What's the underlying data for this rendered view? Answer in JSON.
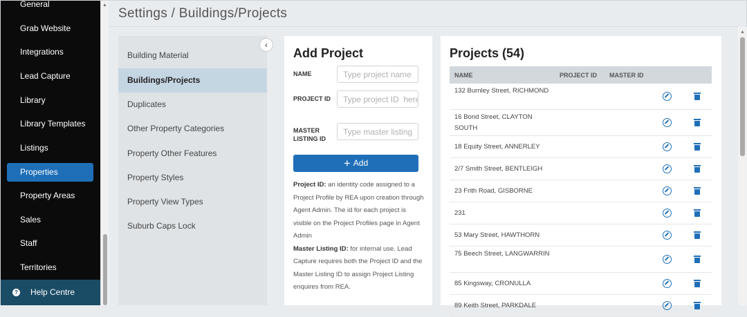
{
  "sidebar": {
    "items": [
      "General",
      "Grab Website",
      "Integrations",
      "Lead Capture",
      "Library",
      "Library Templates",
      "Listings",
      "Properties",
      "Property Areas",
      "Sales",
      "Staff",
      "Territories"
    ],
    "active": "Properties",
    "help": "Help Centre"
  },
  "header": {
    "title": "Settings / Buildings/Projects"
  },
  "settings_nav": {
    "items": [
      "Building Material",
      "Buildings/Projects",
      "Duplicates",
      "Other Property Categories",
      "Property Other Features",
      "Property Styles",
      "Property View Types",
      "Suburb Caps Lock"
    ],
    "active": "Buildings/Projects"
  },
  "add_project": {
    "title": "Add Project",
    "name_label": "NAME",
    "name_placeholder": "Type project name",
    "project_id_label": "PROJECT ID",
    "project_id_placeholder": "Type project ID  here",
    "master_label": "MASTER LISTING ID",
    "master_placeholder": "Type master listing",
    "add_label": "Add",
    "help_project_id_title": "Project ID:",
    "help_project_id_text": "an identity code assigned to a Project Profile by REA upon creation through Agent Admin. The id for each project is visible on the Project Profiles page in Agent Admin",
    "help_master_title": "Master Listing ID:",
    "help_master_text": "for internal use. Lead Capture requires both the Project ID and the Master Listing ID to assign Project Listing enquires from REA."
  },
  "projects": {
    "title": "Projects (54)",
    "columns": [
      "NAME",
      "PROJECT ID",
      "MASTER ID"
    ],
    "rows": [
      "132 Burnley Street, RICHMOND",
      "16 Bond Street, CLAYTON SOUTH",
      "18 Equity Street, ANNERLEY",
      "2/7 Smith Street, BENTLEIGH",
      "23 Frith Road, GISBORNE",
      "231",
      "53 Mary Street, HAWTHORN",
      "75 Beech Street, LANGWARRIN",
      "85 Kingsway, CRONULLA",
      "89 Keith Street, PARKDALE"
    ]
  },
  "colors": {
    "accent": "#1f6fb8",
    "sidebar_bg": "#0b0b0b",
    "help_bg": "#1b4c66"
  }
}
